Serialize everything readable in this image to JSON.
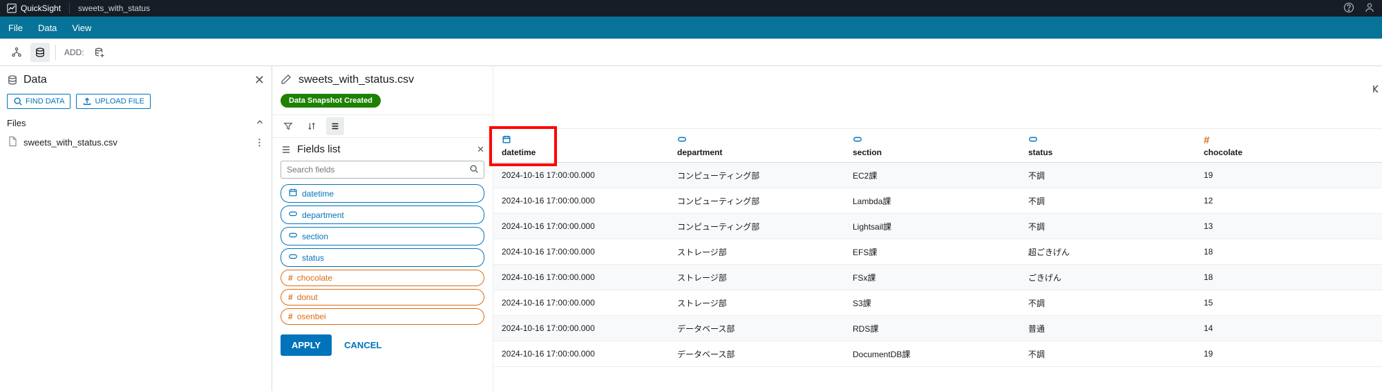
{
  "app": {
    "name": "QuickSight",
    "document": "sweets_with_status"
  },
  "menubar": {
    "file": "File",
    "data": "Data",
    "view": "View"
  },
  "toolbar": {
    "add_label": "ADD:"
  },
  "data_panel": {
    "title": "Data",
    "find_data": "FIND DATA",
    "upload_file": "UPLOAD FILE",
    "files_label": "Files",
    "file_name": "sweets_with_status.csv"
  },
  "dataset": {
    "name": "sweets_with_status.csv",
    "snapshot_badge": "Data Snapshot Created"
  },
  "fields_list": {
    "title": "Fields list",
    "search_placeholder": "Search fields",
    "apply": "APPLY",
    "cancel": "CANCEL",
    "fields": [
      {
        "name": "datetime",
        "kind": "date"
      },
      {
        "name": "department",
        "kind": "string"
      },
      {
        "name": "section",
        "kind": "string"
      },
      {
        "name": "status",
        "kind": "string"
      },
      {
        "name": "chocolate",
        "kind": "number"
      },
      {
        "name": "donut",
        "kind": "number"
      },
      {
        "name": "osenbei",
        "kind": "number"
      }
    ]
  },
  "columns": [
    {
      "name": "datetime",
      "type": "date"
    },
    {
      "name": "department",
      "type": "string"
    },
    {
      "name": "section",
      "type": "string"
    },
    {
      "name": "status",
      "type": "string"
    },
    {
      "name": "chocolate",
      "type": "number"
    }
  ],
  "rows": [
    {
      "datetime": "2024-10-16 17:00:00.000",
      "department": "コンピューティング部",
      "section": "EC2課",
      "status": "不調",
      "chocolate": "19"
    },
    {
      "datetime": "2024-10-16 17:00:00.000",
      "department": "コンピューティング部",
      "section": "Lambda課",
      "status": "不調",
      "chocolate": "12"
    },
    {
      "datetime": "2024-10-16 17:00:00.000",
      "department": "コンピューティング部",
      "section": "Lightsail課",
      "status": "不調",
      "chocolate": "13"
    },
    {
      "datetime": "2024-10-16 17:00:00.000",
      "department": "ストレージ部",
      "section": "EFS課",
      "status": "超ごきげん",
      "chocolate": "18"
    },
    {
      "datetime": "2024-10-16 17:00:00.000",
      "department": "ストレージ部",
      "section": "FSx課",
      "status": "ごきげん",
      "chocolate": "18"
    },
    {
      "datetime": "2024-10-16 17:00:00.000",
      "department": "ストレージ部",
      "section": "S3課",
      "status": "不調",
      "chocolate": "15"
    },
    {
      "datetime": "2024-10-16 17:00:00.000",
      "department": "データベース部",
      "section": "RDS課",
      "status": "普通",
      "chocolate": "14"
    },
    {
      "datetime": "2024-10-16 17:00:00.000",
      "department": "データベース部",
      "section": "DocumentDB課",
      "status": "不調",
      "chocolate": "19"
    }
  ]
}
